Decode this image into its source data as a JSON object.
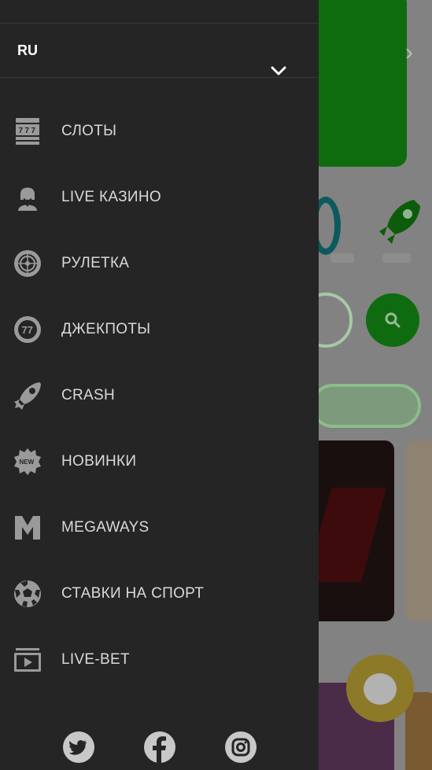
{
  "language": {
    "current": "RU"
  },
  "menu": [
    {
      "label": "СЛОТЫ",
      "icon": "slot-machine-icon"
    },
    {
      "label": "LIVE КАЗИНО",
      "icon": "live-dealer-icon"
    },
    {
      "label": "РУЛЕТКА",
      "icon": "roulette-icon"
    },
    {
      "label": "ДЖЕКПОТЫ",
      "icon": "jackpot-77-icon"
    },
    {
      "label": "CRASH",
      "icon": "rocket-icon"
    },
    {
      "label": "НОВИНКИ",
      "icon": "new-badge-icon"
    },
    {
      "label": "MEGAWAYS",
      "icon": "megaways-m-icon"
    },
    {
      "label": "СТАВКИ НА СПОРТ",
      "icon": "soccer-ball-icon"
    },
    {
      "label": "LIVE-BET",
      "icon": "live-bet-play-icon"
    }
  ],
  "social": [
    {
      "icon": "twitter-icon"
    },
    {
      "icon": "facebook-icon"
    },
    {
      "icon": "instagram-icon"
    }
  ],
  "colors": {
    "drawer_bg": "#252525",
    "overlay_bg": "#828282",
    "icon_gray": "#9a9a9a",
    "label_text": "#d9d9d9"
  },
  "icons": {
    "lang_toggle": "chevron-down-icon",
    "new_badge_text": "NEW",
    "jackpot_text": "77"
  }
}
